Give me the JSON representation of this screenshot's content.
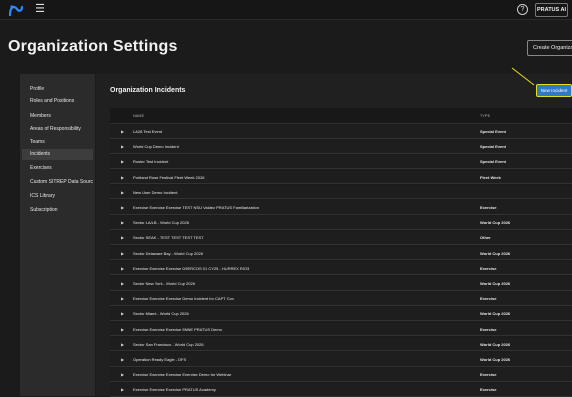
{
  "topbar": {
    "logo_icon": "app-logo-icon",
    "menu_icon": "hamburger-icon",
    "help_icon": "help-icon",
    "account_label": "PRATUS AI"
  },
  "header": {
    "title": "Organization Settings",
    "create_button": "Create Organization"
  },
  "sidebar": {
    "items": [
      {
        "label": "Profile"
      },
      {
        "label": "Roles and Positions"
      },
      {
        "label": "Members"
      },
      {
        "label": "Areas of Responsibility"
      },
      {
        "label": "Teams"
      },
      {
        "label": "Incidents"
      },
      {
        "label": "Exercises"
      },
      {
        "label": "Custom SITREP Data Sources"
      },
      {
        "label": "ICS Library"
      },
      {
        "label": "Subscription"
      }
    ],
    "active_index": 5
  },
  "main": {
    "title": "Organization Incidents",
    "new_button": "New Incident",
    "columns": [
      "NAME",
      "TYPE"
    ],
    "rows": [
      {
        "name": "LA28 Test Event",
        "type": "Special Event"
      },
      {
        "name": "World Cup Demo Incident",
        "type": "Special Event"
      },
      {
        "name": "Roster Test Incident",
        "type": "Special Event"
      },
      {
        "name": "Portland Rose Festival Fleet Week 2026",
        "type": "Fleet Week"
      },
      {
        "name": "New User Demo Incident",
        "type": ""
      },
      {
        "name": "Exercise Exercise Exercise TEST NSU Valdez PRATUS Familiarization",
        "type": "Exercise"
      },
      {
        "name": "Sector LA/LB - World Cup 2026",
        "type": "World Cup 2026"
      },
      {
        "name": "Sector SEAK - TEST TEST TEST TEST",
        "type": "Other"
      },
      {
        "name": "Sector Delaware Bay - World Cup 2026",
        "type": "World Cup 2026"
      },
      {
        "name": "Exercise Exercise Exercise D9ERCOS 01 CY25 - HURREX RIO3",
        "type": "Exercise"
      },
      {
        "name": "Sector New York - World Cup 2026",
        "type": "World Cup 2026"
      },
      {
        "name": "Exercise Exercise Exercise Demo Incident for CAPT Cox",
        "type": "Exercise"
      },
      {
        "name": "Sector Miami - World Cup 2026",
        "type": "World Cup 2026"
      },
      {
        "name": "Exercise Exercise Exercise 5NNE PRATUS Demo",
        "type": "Exercise"
      },
      {
        "name": "Sector San Francisco - World Cup 2026",
        "type": "World Cup 2026"
      },
      {
        "name": "Operation Ready Eagle - DFS",
        "type": "World Cup 2026"
      },
      {
        "name": "Exercise Exercise Exercise Exercise Demo for Webinar",
        "type": "Exercise"
      },
      {
        "name": "Exercise Exercise Exercise PRATUS Academy",
        "type": "Exercise"
      }
    ]
  },
  "colors": {
    "accent_blue": "#2f79c5",
    "highlight_yellow": "#e7dd1f",
    "logo_blue": "#2e8bff"
  }
}
